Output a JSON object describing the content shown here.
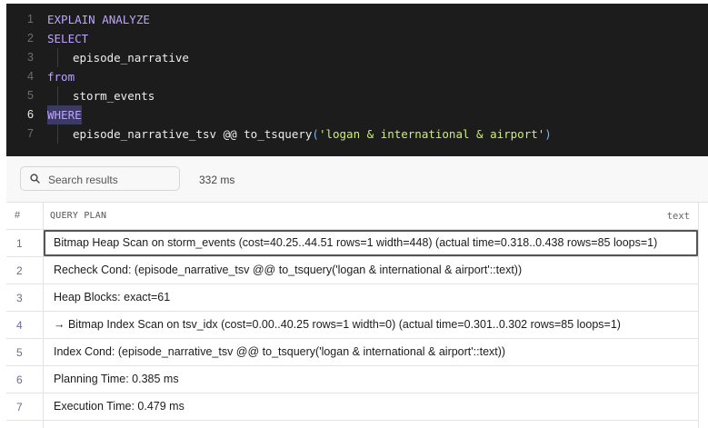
{
  "editor": {
    "line_numbers": [
      "1",
      "2",
      "3",
      "4",
      "5",
      "6",
      "7"
    ],
    "line1_kw": "EXPLAIN ANALYZE",
    "line2_kw": "SELECT",
    "line3_text": "episode_narrative",
    "line4_kw": "from",
    "line5_text": "storm_events",
    "line6_kw": "WHERE",
    "line7_col": "episode_narrative_tsv @@ to_tsquery",
    "line7_open": "(",
    "line7_str": "'logan & international & airport'",
    "line7_close": ")"
  },
  "toolbar": {
    "search_placeholder": "Search results",
    "timing": "332 ms"
  },
  "results": {
    "index_header": "#",
    "column_name": "QUERY PLAN",
    "column_type": "text",
    "rows": [
      {
        "num": "1",
        "text": "Bitmap Heap Scan on storm_events (cost=40.25..44.51 rows=1 width=448) (actual time=0.318..0.438 rows=85 loops=1)"
      },
      {
        "num": "2",
        "text": "Recheck Cond: (episode_narrative_tsv @@ to_tsquery('logan & international & airport'::text))"
      },
      {
        "num": "3",
        "text": "Heap Blocks: exact=61"
      },
      {
        "num": "4",
        "text": "→ Bitmap Index Scan on tsv_idx (cost=0.00..40.25 rows=1 width=0) (actual time=0.301..0.302 rows=85 loops=1)"
      },
      {
        "num": "5",
        "text": "Index Cond: (episode_narrative_tsv @@ to_tsquery('logan & international & airport'::text))"
      },
      {
        "num": "6",
        "text": "Planning Time: 0.385 ms"
      },
      {
        "num": "7",
        "text": "Execution Time: 0.479 ms"
      }
    ]
  },
  "colors": {
    "editor_bg": "#1c1c1c",
    "keyword": "#bda4ff",
    "string": "#ccf06e",
    "paren": "#6fb8ff",
    "selected_cell_border": "#555555"
  }
}
